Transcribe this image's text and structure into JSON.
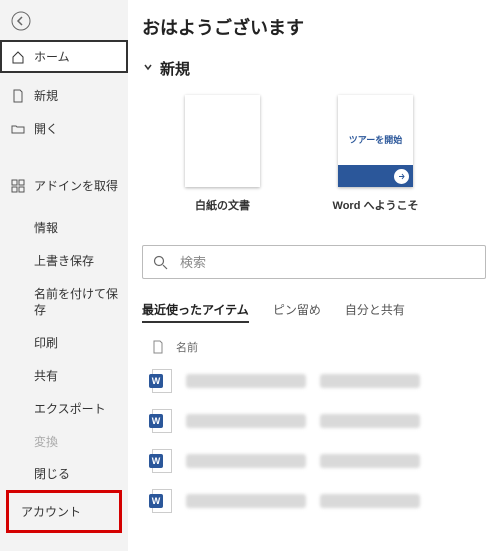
{
  "greeting": "おはようございます",
  "section_new": "新規",
  "templates": {
    "blank": {
      "caption": "白紙の文書"
    },
    "welcome": {
      "caption": "Word へようこそ",
      "tour": "ツアーを開始"
    }
  },
  "search": {
    "placeholder": "検索"
  },
  "tabs": {
    "recent": "最近使ったアイテム",
    "pinned": "ピン留め",
    "shared": "自分と共有"
  },
  "list": {
    "header_name": "名前"
  },
  "sidebar": {
    "home": "ホーム",
    "new": "新規",
    "open": "開く",
    "addins": "アドインを取得",
    "info": "情報",
    "save": "上書き保存",
    "saveas": "名前を付けて保存",
    "print": "印刷",
    "share": "共有",
    "export": "エクスポート",
    "transform": "変換",
    "close": "閉じる",
    "account": "アカウント"
  },
  "word_logo_letter": "W"
}
